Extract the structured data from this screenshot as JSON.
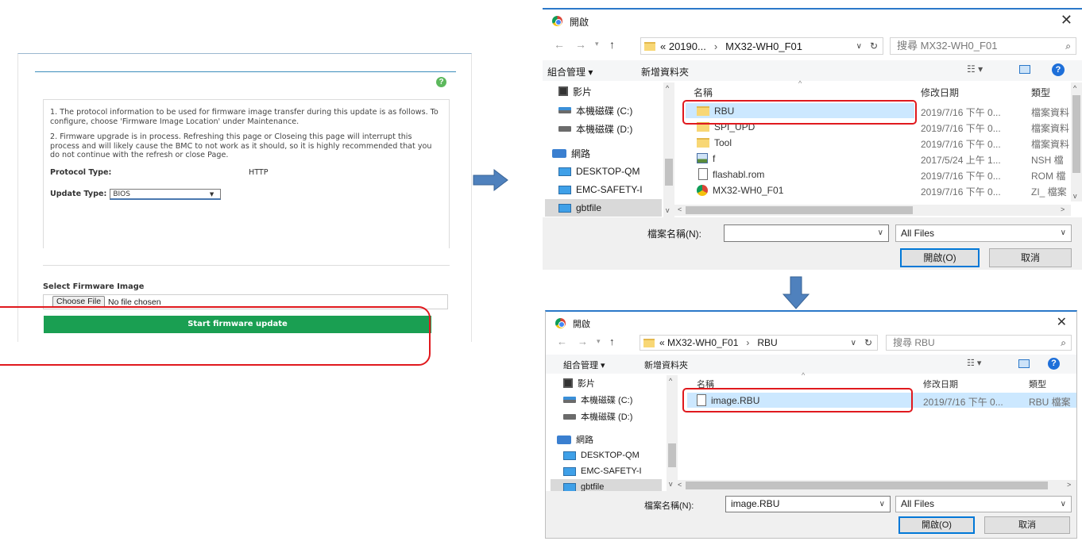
{
  "firmware_panel": {
    "info_p1": "1. The protocol information to be used for firmware image transfer during this update is as follows. To configure, choose 'Firmware Image Location' under Maintenance.",
    "info_p2": "2. Firmware upgrade is in process. Refreshing this page or Closeing this page will interrupt this process and will likely cause the BMC to not work as it should, so it is highly recommended that you do not continue with the refresh or close Page.",
    "protocol_label": "Protocol Type:",
    "protocol_value": "HTTP",
    "update_type_label": "Update Type:",
    "update_type_value": "BIOS",
    "select_label": "Select Firmware Image",
    "choose_file": "Choose File",
    "no_file": "No file chosen",
    "start_button": "Start firmware update"
  },
  "dialog1": {
    "title": "開啟",
    "address": [
      "« 20190...",
      "›",
      "MX32-WH0_F01"
    ],
    "search_placeholder": "搜尋 MX32-WH0_F01",
    "organize": "組合管理 ▾",
    "new_folder": "新增資料夾",
    "tree": [
      "影片",
      "本機磁碟 (C:)",
      "本機磁碟 (D:)",
      "網路",
      "DESKTOP-QM",
      "EMC-SAFETY-I",
      "gbtfile"
    ],
    "columns": {
      "name": "名稱",
      "date": "修改日期",
      "type": "類型"
    },
    "files": [
      {
        "name": "RBU",
        "date": "2019/7/16 下午 0...",
        "type": "檔案資料",
        "icon": "folder-icon"
      },
      {
        "name": "SPI_UPD",
        "date": "2019/7/16 下午 0...",
        "type": "檔案資料",
        "icon": "folder-icon"
      },
      {
        "name": "Tool",
        "date": "2019/7/16 下午 0...",
        "type": "檔案資料",
        "icon": "folder-icon"
      },
      {
        "name": "f",
        "date": "2017/5/24 上午 1...",
        "type": "NSH 檔",
        "icon": "image-file-icon"
      },
      {
        "name": "flashabl.rom",
        "date": "2019/7/16 下午 0...",
        "type": "ROM 檔",
        "icon": "file-icon"
      },
      {
        "name": "MX32-WH0_F01",
        "date": "2019/7/16 下午 0...",
        "type": "ZI_ 檔案",
        "icon": "chrome-file-icon"
      }
    ],
    "filename_label": "檔案名稱(N):",
    "filename_value": "",
    "filter": "All Files",
    "open_button": "開啟(O)",
    "cancel_button": "取消"
  },
  "dialog2": {
    "title": "開啟",
    "address": [
      "« MX32-WH0_F01",
      "›",
      "RBU"
    ],
    "search_placeholder": "搜尋 RBU",
    "organize": "組合管理 ▾",
    "new_folder": "新增資料夾",
    "tree": [
      "影片",
      "本機磁碟 (C:)",
      "本機磁碟 (D:)",
      "網路",
      "DESKTOP-QM",
      "EMC-SAFETY-I",
      "gbtfile"
    ],
    "columns": {
      "name": "名稱",
      "date": "修改日期",
      "type": "類型"
    },
    "files": [
      {
        "name": "image.RBU",
        "date": "2019/7/16 下午 0...",
        "type": "RBU 檔案",
        "icon": "file-icon"
      }
    ],
    "filename_label": "檔案名稱(N):",
    "filename_value": "image.RBU",
    "filter": "All Files",
    "open_button": "開啟(O)",
    "cancel_button": "取消"
  },
  "colors": {
    "accent_red": "#e0191e",
    "arrow_blue": "#4f81bd",
    "start_green": "#1a9f52",
    "selection_blue": "#cce8ff"
  }
}
